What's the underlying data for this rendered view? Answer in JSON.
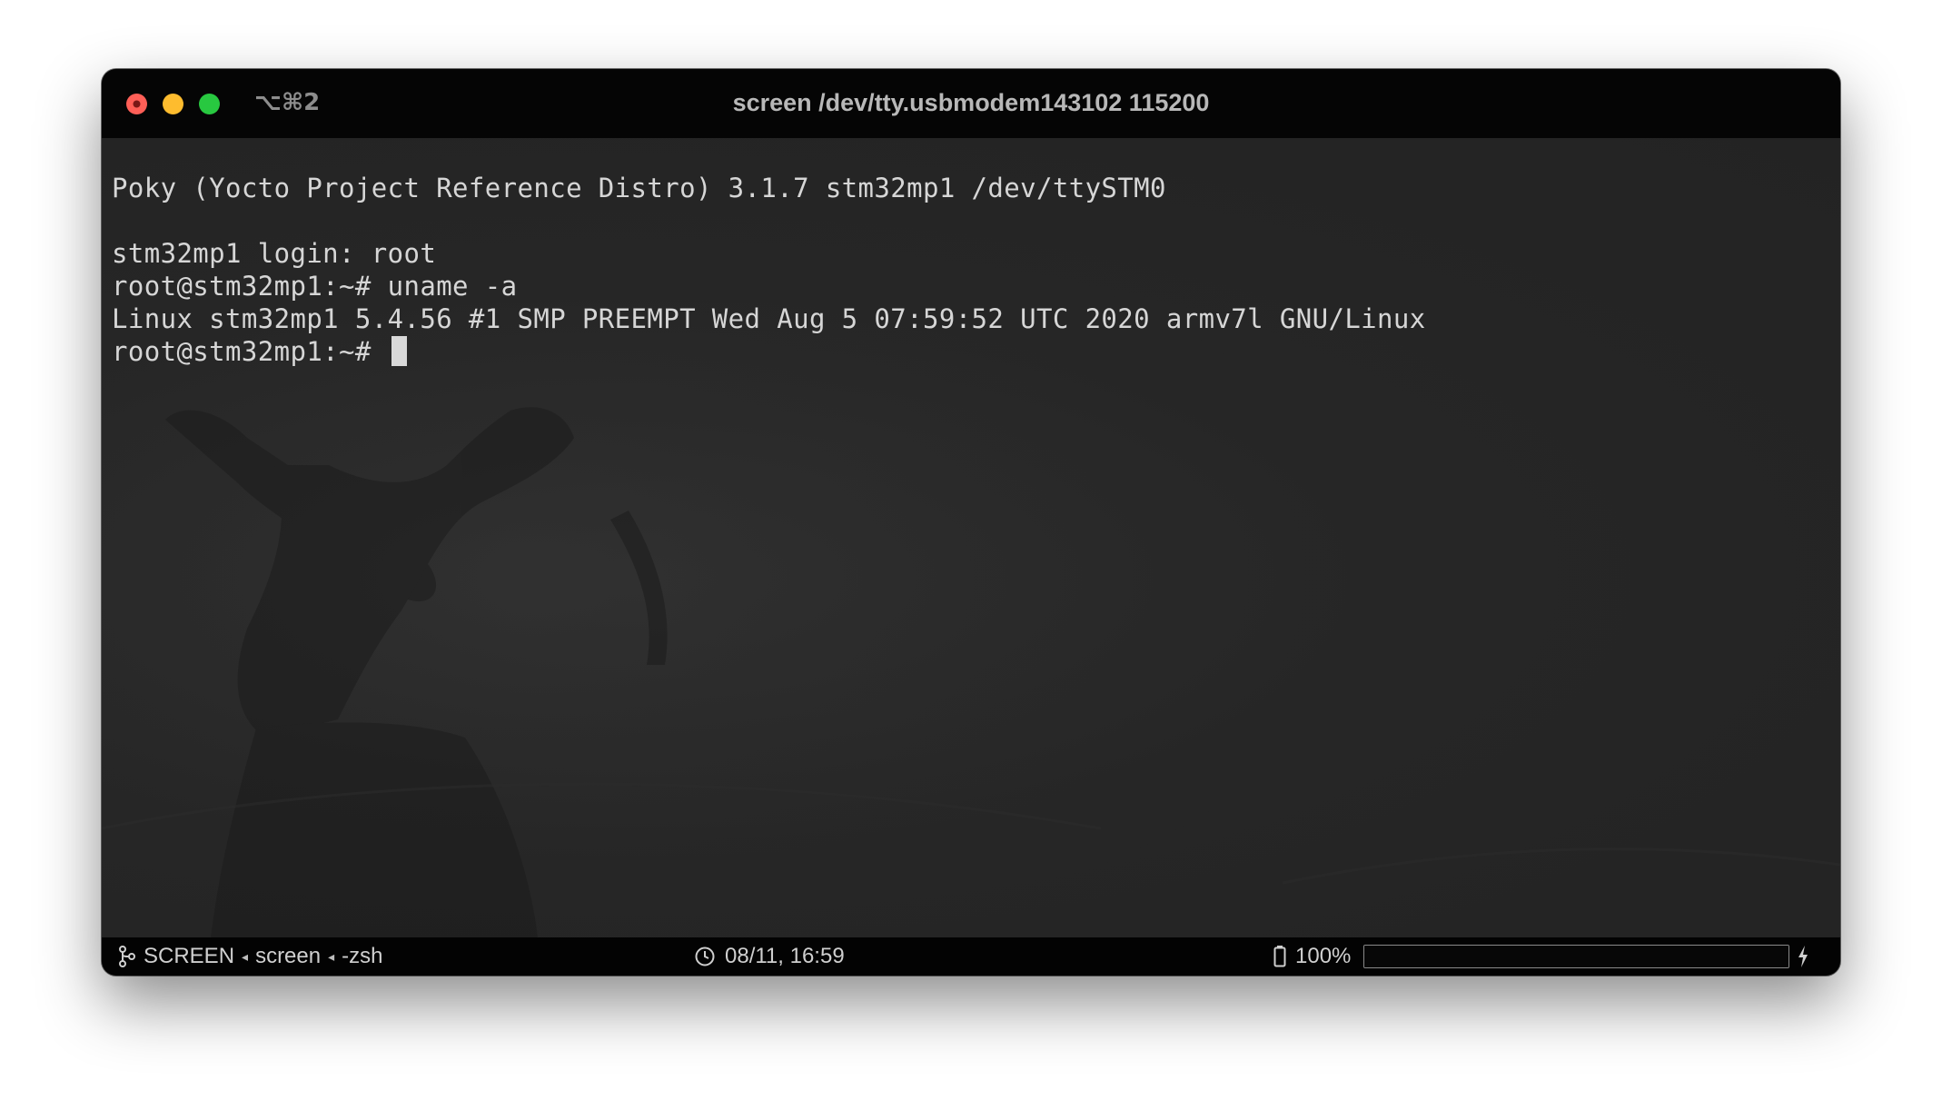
{
  "window": {
    "shortcut": "⌥⌘2",
    "title": "screen /dev/tty.usbmodem143102 115200"
  },
  "terminal": {
    "lines": [
      "Poky (Yocto Project Reference Distro) 3.1.7 stm32mp1 /dev/ttySTM0",
      "",
      "stm32mp1 login: root",
      "root@stm32mp1:~# uname -a",
      "Linux stm32mp1 5.4.56 #1 SMP PREEMPT Wed Aug 5 07:59:52 UTC 2020 armv7l GNU/Linux",
      "root@stm32mp1:~# "
    ]
  },
  "statusbar": {
    "session": "SCREEN",
    "separator": "◂",
    "process": "screen",
    "shell": "-zsh",
    "datetime": "08/11, 16:59",
    "battery_label": "100%",
    "battery_level": 1.0
  },
  "colors": {
    "close": "#ff5f57",
    "minimize": "#febc2e",
    "maximize": "#28c840"
  }
}
